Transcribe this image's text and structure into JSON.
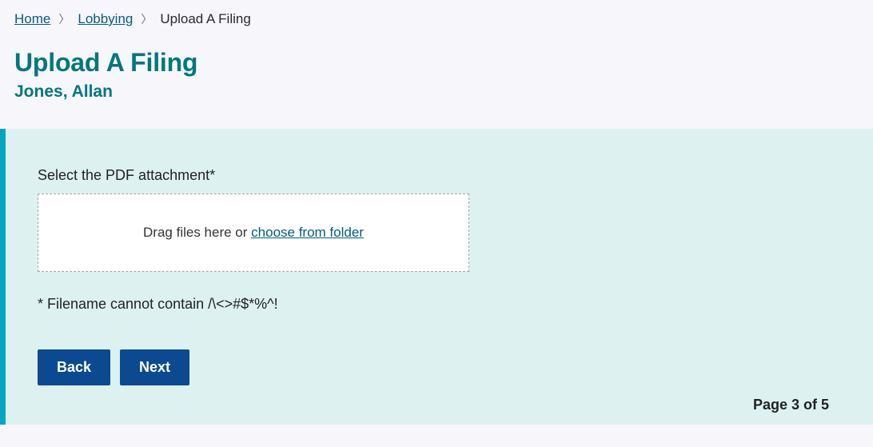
{
  "breadcrumb": {
    "home": "Home",
    "lobbying": "Lobbying",
    "current": "Upload A Filing"
  },
  "page": {
    "title": "Upload A Filing",
    "subtitle": "Jones, Allan"
  },
  "form": {
    "select_label": "Select the PDF attachment*",
    "drag_text": "Drag files here or ",
    "choose_link": "choose from folder",
    "filename_note": "* Filename cannot contain /\\<>#$*%^!",
    "back_label": "Back",
    "next_label": "Next"
  },
  "pager": {
    "text": "Page 3 of 5",
    "current": 3,
    "total": 5
  }
}
